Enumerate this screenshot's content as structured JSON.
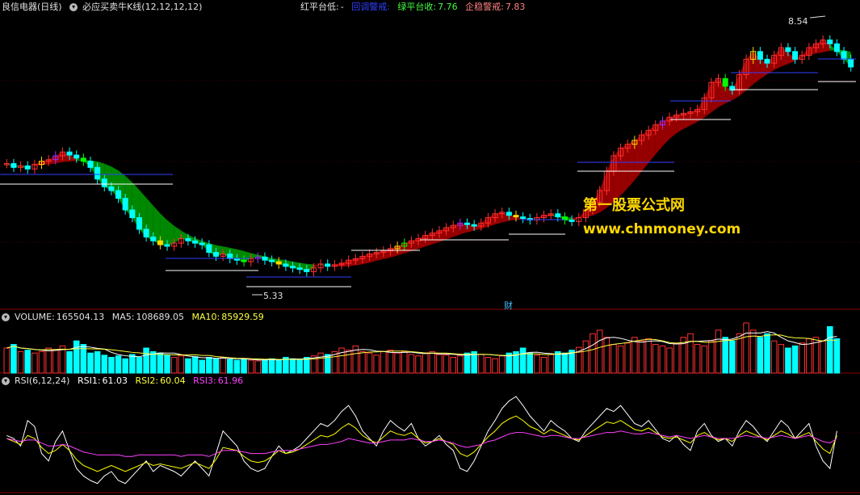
{
  "header": {
    "stock_name": "良信电器(日线)",
    "indicator_name": "必应买卖牛K线(12,12,12,12)",
    "red_platform_low_label": "红平台低:",
    "red_platform_low_value": "-",
    "pullback_warning_label": "回调警戒:",
    "green_platform_close_label": "绿平台收:",
    "green_platform_close_value": "7.76",
    "stable_warning_label": "企稳警戒:",
    "stable_warning_value": "7.83"
  },
  "volume_panel": {
    "label": "VOLUME:",
    "volume": "165504.13",
    "ma5_label": "MA5:",
    "ma5": "108689.05",
    "ma10_label": "MA10:",
    "ma10": "85929.59"
  },
  "rsi_panel": {
    "label": "RSI(6,12,24)",
    "rsi1_label": "RSI1:",
    "rsi1": "61.03",
    "rsi2_label": "RSI2:",
    "rsi2": "60.04",
    "rsi3_label": "RSI3:",
    "rsi3": "61.96"
  },
  "watermark": {
    "line1": "第一股票公式网",
    "line2": "www.chnmoney.com"
  },
  "markers": {
    "high_label": "8.54",
    "low_label": "5.33",
    "event1": " ",
    "event2": "财"
  },
  "colors": {
    "background": "#000000",
    "up": "#ff3030",
    "down": "#00ffff",
    "yellow": "#ffd800",
    "green_band": "#00a000",
    "red_band": "#b00000",
    "rsi1": "#ffffff",
    "rsi2": "#ffff00",
    "rsi3": "#ff40ff",
    "grid": "#8b0000"
  },
  "chart_data": {
    "type": "candlestick",
    "price_range": [
      5.0,
      8.7
    ],
    "closes": [
      6.75,
      6.7,
      6.72,
      6.68,
      6.74,
      6.78,
      6.8,
      6.85,
      6.9,
      6.86,
      6.82,
      6.78,
      6.7,
      6.55,
      6.45,
      6.4,
      6.3,
      6.15,
      6.05,
      5.9,
      5.8,
      5.75,
      5.7,
      5.68,
      5.72,
      5.78,
      5.75,
      5.72,
      5.7,
      5.6,
      5.55,
      5.58,
      5.52,
      5.5,
      5.48,
      5.52,
      5.54,
      5.5,
      5.48,
      5.45,
      5.42,
      5.4,
      5.38,
      5.35,
      5.4,
      5.45,
      5.42,
      5.44,
      5.46,
      5.5,
      5.52,
      5.55,
      5.58,
      5.6,
      5.62,
      5.65,
      5.68,
      5.72,
      5.75,
      5.78,
      5.82,
      5.85,
      5.88,
      5.92,
      5.95,
      5.98,
      5.96,
      5.94,
      5.98,
      6.05,
      6.1,
      6.12,
      6.08,
      6.06,
      6.04,
      6.02,
      6.05,
      6.08,
      6.1,
      6.06,
      6.02,
      6.0,
      6.05,
      6.15,
      6.25,
      6.4,
      6.65,
      6.85,
      6.95,
      7.0,
      7.05,
      7.12,
      7.18,
      7.25,
      7.3,
      7.35,
      7.38,
      7.4,
      7.42,
      7.45,
      7.6,
      7.8,
      7.85,
      7.75,
      7.7,
      7.9,
      8.1,
      8.2,
      8.1,
      8.05,
      8.15,
      8.25,
      8.2,
      8.1,
      8.15,
      8.25,
      8.3,
      8.35,
      8.3,
      8.2,
      8.1,
      8.0
    ],
    "volumes": [
      35,
      40,
      30,
      32,
      28,
      30,
      35,
      33,
      38,
      30,
      45,
      40,
      28,
      30,
      25,
      22,
      24,
      20,
      26,
      22,
      35,
      30,
      28,
      25,
      22,
      24,
      20,
      23,
      18,
      22,
      20,
      22,
      19,
      18,
      20,
      18,
      17,
      19,
      20,
      18,
      22,
      20,
      18,
      22,
      24,
      28,
      26,
      30,
      35,
      32,
      38,
      30,
      28,
      25,
      30,
      32,
      28,
      30,
      26,
      24,
      28,
      30,
      26,
      25,
      22,
      24,
      28,
      30,
      26,
      22,
      20,
      24,
      28,
      30,
      35,
      28,
      25,
      22,
      26,
      30,
      28,
      32,
      36,
      45,
      55,
      60,
      50,
      40,
      38,
      42,
      50,
      45,
      48,
      40,
      38,
      35,
      42,
      50,
      55,
      40,
      38,
      45,
      60,
      50,
      45,
      55,
      70,
      60,
      50,
      55,
      45,
      40,
      35,
      38,
      42,
      48,
      50,
      45,
      65,
      48
    ],
    "rsi1": [
      52,
      50,
      45,
      62,
      58,
      40,
      35,
      48,
      55,
      42,
      30,
      25,
      22,
      20,
      25,
      28,
      22,
      20,
      25,
      30,
      35,
      28,
      32,
      30,
      28,
      25,
      30,
      35,
      30,
      25,
      40,
      55,
      50,
      45,
      35,
      30,
      28,
      30,
      38,
      45,
      40,
      42,
      45,
      50,
      55,
      60,
      58,
      62,
      68,
      72,
      65,
      55,
      50,
      45,
      55,
      62,
      58,
      55,
      60,
      50,
      45,
      48,
      52,
      46,
      42,
      30,
      28,
      35,
      45,
      55,
      62,
      70,
      75,
      78,
      72,
      65,
      60,
      55,
      62,
      58,
      55,
      50,
      48,
      55,
      60,
      65,
      70,
      68,
      72,
      66,
      60,
      58,
      62,
      56,
      50,
      48,
      52,
      46,
      42,
      55,
      60,
      52,
      48,
      50,
      45,
      55,
      62,
      58,
      52,
      48,
      55,
      62,
      58,
      50,
      55,
      60,
      45,
      35,
      30,
      55
    ],
    "rsi2": [
      50,
      48,
      46,
      52,
      50,
      44,
      40,
      42,
      46,
      42,
      36,
      32,
      30,
      28,
      30,
      32,
      30,
      28,
      30,
      32,
      34,
      32,
      33,
      32,
      31,
      30,
      32,
      34,
      32,
      30,
      36,
      44,
      43,
      42,
      38,
      35,
      34,
      35,
      38,
      42,
      40,
      41,
      43,
      46,
      49,
      52,
      51,
      53,
      57,
      60,
      57,
      52,
      49,
      47,
      51,
      55,
      53,
      52,
      54,
      50,
      47,
      48,
      50,
      48,
      46,
      40,
      38,
      41,
      46,
      51,
      55,
      60,
      63,
      65,
      62,
      58,
      56,
      53,
      56,
      54,
      52,
      50,
      49,
      52,
      55,
      58,
      61,
      60,
      62,
      59,
      56,
      55,
      57,
      54,
      51,
      50,
      51,
      49,
      47,
      52,
      54,
      51,
      49,
      50,
      48,
      52,
      55,
      53,
      51,
      49,
      52,
      55,
      53,
      50,
      52,
      54,
      48,
      43,
      40,
      52
    ],
    "rsi3": [
      50,
      49,
      48,
      49,
      49,
      47,
      45,
      45,
      46,
      45,
      43,
      41,
      40,
      39,
      39,
      39,
      39,
      38,
      38,
      39,
      39,
      39,
      39,
      39,
      39,
      38,
      39,
      39,
      39,
      38,
      40,
      42,
      42,
      42,
      41,
      40,
      40,
      40,
      41,
      42,
      42,
      42,
      43,
      44,
      45,
      46,
      46,
      47,
      48,
      50,
      49,
      48,
      47,
      47,
      48,
      49,
      49,
      49,
      50,
      49,
      48,
      48,
      49,
      48,
      47,
      45,
      44,
      45,
      46,
      48,
      49,
      51,
      53,
      54,
      54,
      53,
      52,
      51,
      52,
      52,
      51,
      50,
      50,
      51,
      52,
      53,
      54,
      54,
      55,
      54,
      53,
      53,
      54,
      53,
      52,
      51,
      52,
      51,
      50,
      51,
      52,
      51,
      50,
      50,
      50,
      51,
      52,
      51,
      51,
      50,
      51,
      52,
      51,
      50,
      51,
      52,
      50,
      48,
      47,
      50
    ]
  }
}
